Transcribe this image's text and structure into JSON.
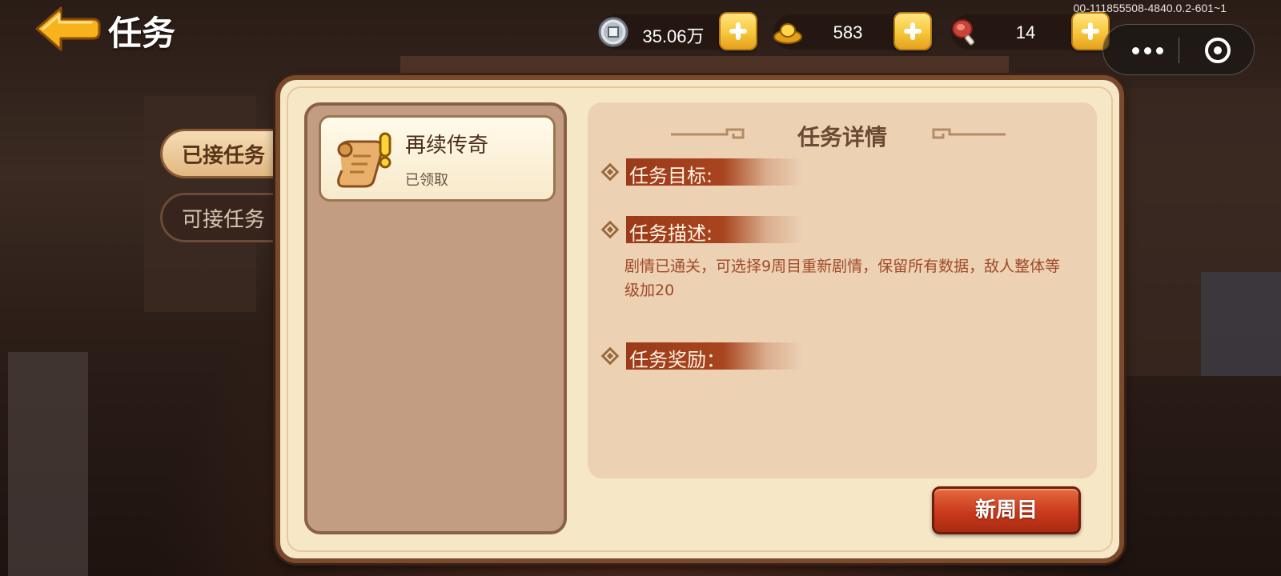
{
  "header": {
    "title": "任务",
    "version": "00-111855508-4840.0.2-601~1"
  },
  "currencies": [
    {
      "name": "silver-coin",
      "value": "35.06万"
    },
    {
      "name": "gold-ingot",
      "value": "583"
    },
    {
      "name": "meat",
      "value": "14"
    }
  ],
  "tabs": [
    {
      "label": "已接任务",
      "active": true
    },
    {
      "label": "可接任务",
      "active": false
    }
  ],
  "task_list": [
    {
      "title": "再续传奇",
      "status": "已领取",
      "icon": "scroll-exclamation-icon"
    }
  ],
  "detail": {
    "title": "任务详情",
    "goal_label": "任务目标:",
    "desc_label": "任务描述:",
    "desc_text": "剧情已通关，可选择9周目重新剧情，保留所有数据，敌人整体等级加20",
    "reward_label": "任务奖励："
  },
  "buttons": {
    "new_round": "新周目"
  },
  "colors": {
    "accent_red": "#c93a1c",
    "label_bar": "#9b3a1a",
    "panel_bg": "#f6e8c6",
    "desc_text": "#a04a2a"
  }
}
